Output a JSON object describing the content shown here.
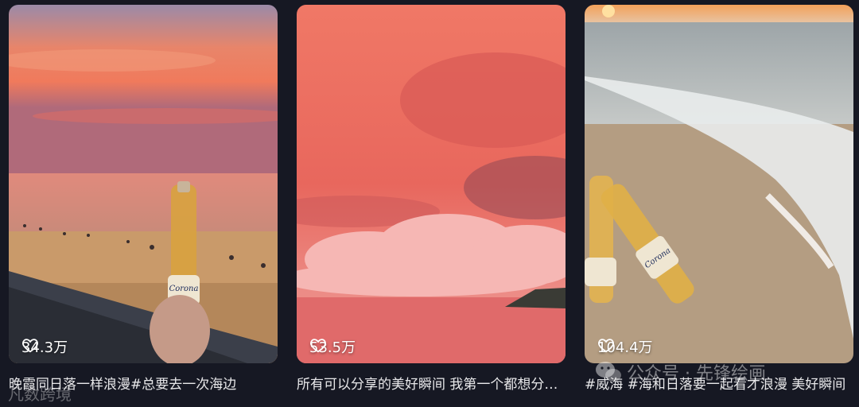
{
  "cards": [
    {
      "likes": "34.3万",
      "caption": "晚霞同日落一样浪漫#总要去一次海边",
      "bottle_text": "Corona"
    },
    {
      "likes": "53.5万",
      "caption": "所有可以分享的美好瞬间 我第一个都想分享给你"
    },
    {
      "likes": "104.4万",
      "caption": "#威海 #海和日落要一起看才浪漫 美好瞬间",
      "bottle_text": "Corona"
    }
  ],
  "watermarks": {
    "left": "凡数跨境",
    "right": "公众号 · 先锋绘画"
  },
  "colors": {
    "background": "#161823",
    "text": "#e8e8ea"
  },
  "icons": [
    "heart-icon",
    "wechat-icon"
  ]
}
